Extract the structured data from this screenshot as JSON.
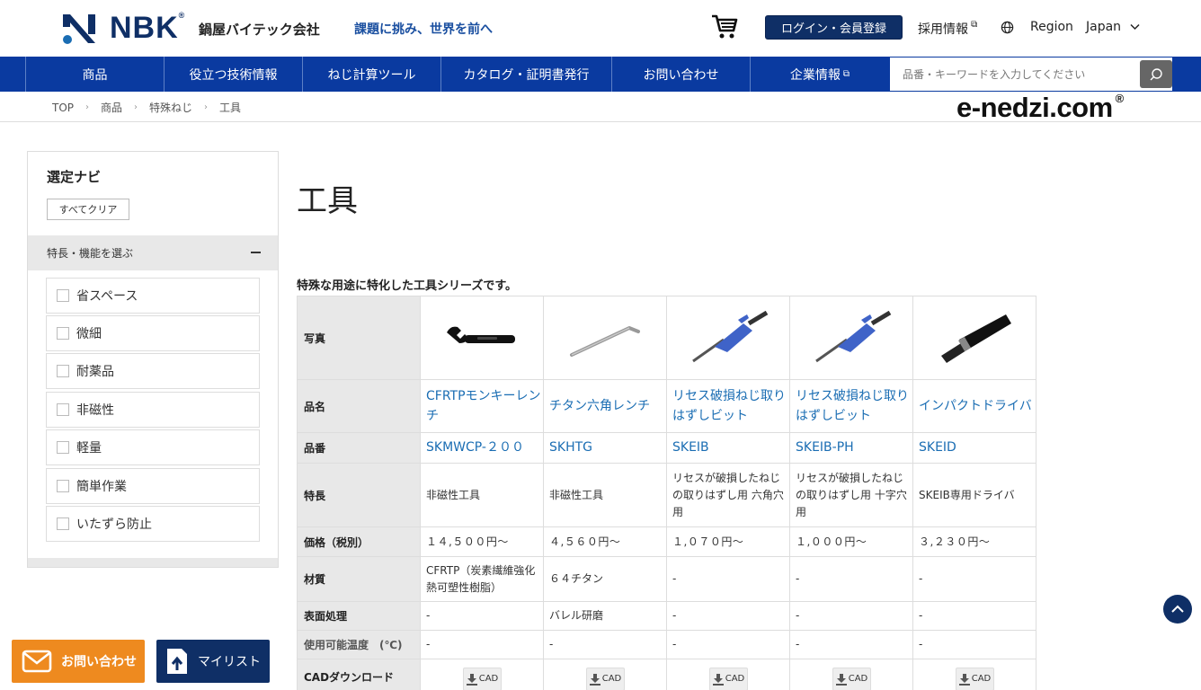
{
  "header": {
    "logo_text": "NBK",
    "company_name": "鍋屋バイテック会社",
    "tagline": "課題に挑み、世界を前へ",
    "login_label": "ログイン・会員登録",
    "recruit_label": "採用情報",
    "region_label": "Region",
    "region_value": "Japan"
  },
  "nav": {
    "items": [
      "商品",
      "役立つ技術情報",
      "ねじ計算ツール",
      "カタログ・証明書発行",
      "お問い合わせ",
      "企業情報"
    ],
    "search_placeholder": "品番・キーワードを入力してください"
  },
  "breadcrumb": [
    "TOP",
    "商品",
    "特殊ねじ",
    "工具"
  ],
  "site_brand": "e-nedzi.com",
  "sidebar": {
    "title": "選定ナビ",
    "clear_label": "すべてクリア",
    "section_label": "特長・機能を選ぶ",
    "features": [
      "省スペース",
      "微細",
      "耐薬品",
      "非磁性",
      "軽量",
      "簡単作業",
      "いたずら防止"
    ]
  },
  "main": {
    "title": "工具",
    "lead": "特殊な用途に特化した工具シリーズです。"
  },
  "table": {
    "row_headers": {
      "photo": "写真",
      "name": "品名",
      "code": "品番",
      "feature": "特長",
      "price": "価格（税別）",
      "material": "材質",
      "surface": "表面処理",
      "temp": "使用可能温度　(℃)",
      "cad": "CADダウンロード"
    },
    "products": [
      {
        "name": "CFRTPモンキーレンチ",
        "code": "SKMWCP-２００",
        "feature": "非磁性工具",
        "price": "１４,５００円〜",
        "material": "CFRTP（炭素繊維強化熱可塑性樹脂）",
        "surface": "-",
        "temp": "-",
        "cad": "CAD"
      },
      {
        "name": "チタン六角レンチ",
        "code": "SKHTG",
        "feature": "非磁性工具",
        "price": "４,５６０円〜",
        "material": "６４チタン",
        "surface": "バレル研磨",
        "temp": "-",
        "cad": "CAD"
      },
      {
        "name": "リセス破損ねじ取りはずしビット",
        "code": "SKEIB",
        "feature": "リセスが破損したねじの取りはずし用 六角穴用",
        "price": "１,０７０円〜",
        "material": "-",
        "surface": "-",
        "temp": "-",
        "cad": "CAD"
      },
      {
        "name": "リセス破損ねじ取りはずしビット",
        "code": "SKEIB-PH",
        "feature": "リセスが破損したねじの取りはずし用 十字穴用",
        "price": "１,０００円〜",
        "material": "-",
        "surface": "-",
        "temp": "-",
        "cad": "CAD"
      },
      {
        "name": "インパクトドライバ",
        "code": "SKEID",
        "feature": "SKEIB専用ドライバ",
        "price": "３,２３０円〜",
        "material": "-",
        "surface": "-",
        "temp": "-",
        "cad": "CAD"
      }
    ]
  },
  "floating": {
    "contact_label": "お問い合わせ",
    "mylist_label": "マイリスト"
  }
}
